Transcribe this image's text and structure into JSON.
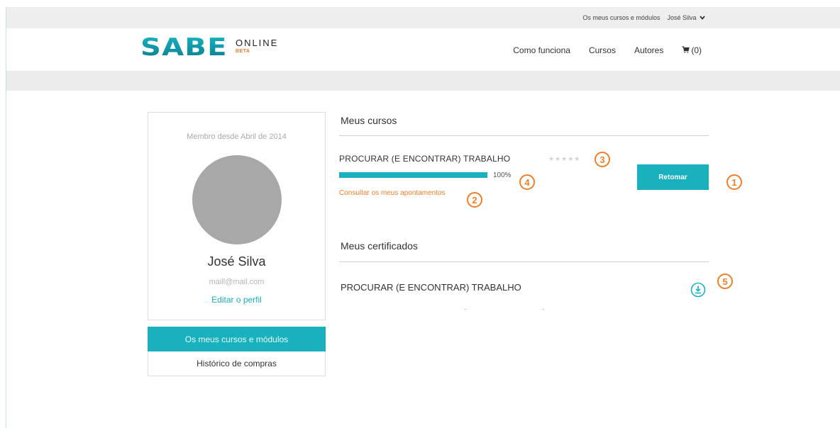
{
  "topbar": {
    "courses_link": "Os meus cursos e módulos",
    "user_name": "José Silva",
    "chevron_icon": "chevron-down-icon"
  },
  "header": {
    "logo_mark": "SABE",
    "logo_online": "ONLINE",
    "logo_beta": "BETA",
    "nav": {
      "how_it_works": "Como funciona",
      "courses": "Cursos",
      "authors": "Autores",
      "cart_count": "(0)",
      "cart_icon": "cart-icon"
    }
  },
  "profile": {
    "member_since": "Membro desde Abril de 2014",
    "name": "José Silva",
    "email": "maill@mail.com",
    "edit_link": "Editar o perfil"
  },
  "menu": {
    "items": [
      {
        "label": "Os meus cursos e módulos",
        "active": true
      },
      {
        "label": "Histórico de compras",
        "active": false
      }
    ]
  },
  "my_courses": {
    "title": "Meus cursos",
    "course": {
      "name": "PROCURAR (E ENCONTRAR) TRABALHO",
      "stars": "★★★★★",
      "rating_filled": 0,
      "rating_max": 5,
      "progress_value": 100,
      "progress_text": "100%",
      "notes_link": "Consultar os meus apontamentos",
      "resume_button": "Retomar"
    }
  },
  "my_certificates": {
    "title": "Meus certificados",
    "certificate": {
      "name": "PROCURAR (E ENCONTRAR) TRABALHO",
      "download_icon": "download-icon"
    }
  },
  "callouts": [
    "1",
    "2",
    "3",
    "4",
    "5"
  ],
  "colors": {
    "accent": "#1ab1bf",
    "callout": "#f07f2a",
    "beta": "#f07f2a"
  }
}
